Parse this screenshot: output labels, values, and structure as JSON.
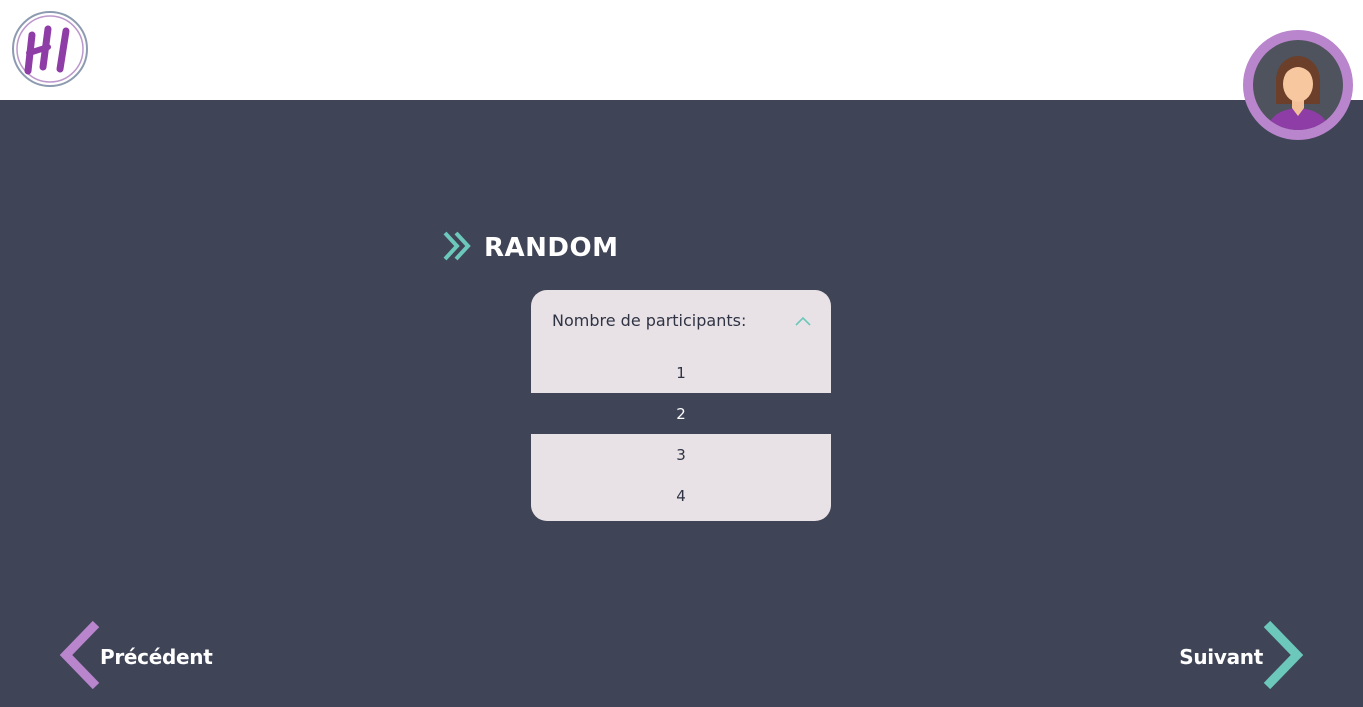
{
  "header": {
    "logo_icon": "hi-logo-icon",
    "avatar_icon": "user-avatar-icon"
  },
  "section": {
    "title": "RANDOM",
    "icon": "double-chevron-right-icon"
  },
  "participants_select": {
    "label": "Nombre de participants:",
    "chevron_icon": "chevron-up-icon",
    "options": [
      "1",
      "2",
      "3",
      "4"
    ],
    "selected": "2"
  },
  "navigation": {
    "prev_label": "Précédent",
    "next_label": "Suivant"
  },
  "colors": {
    "background": "#3f4457",
    "header": "#ffffff",
    "accent_purple": "#b985cc",
    "accent_teal": "#6cc8bb",
    "dropdown_bg": "#e8e2e6"
  }
}
